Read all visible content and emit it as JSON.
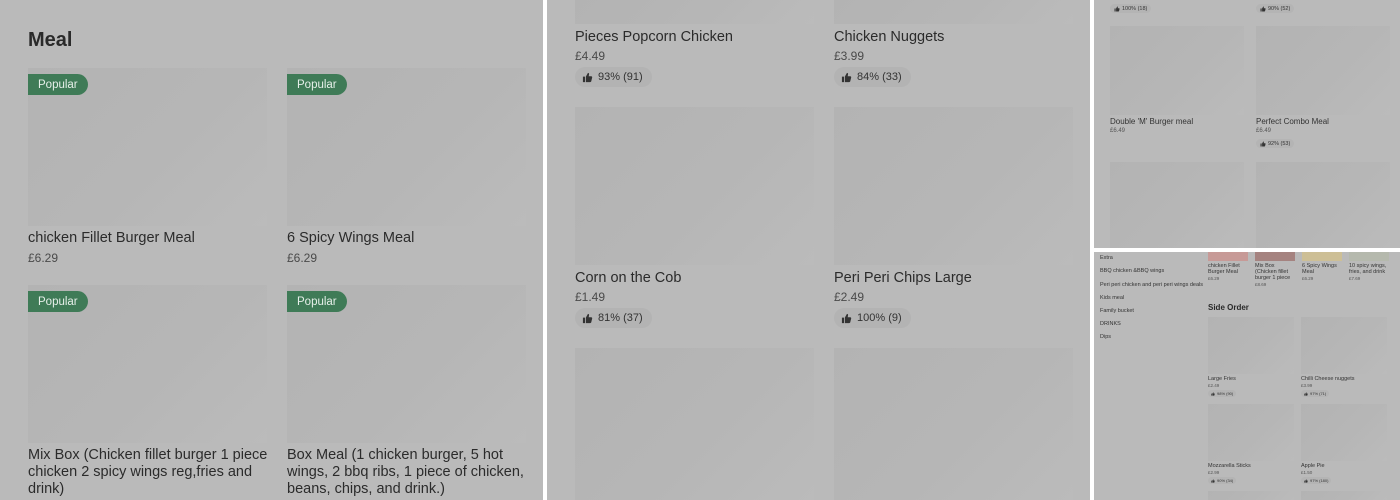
{
  "colors": {
    "panel_bg": "#bababa",
    "badge_green": "#3f7b57",
    "image_placeholder": "#b5b5b5"
  },
  "icons": {
    "rating": "thumbs-up-icon"
  },
  "panel1": {
    "section_title": "Meal",
    "items": [
      {
        "badge": "Popular",
        "name": "chicken Fillet Burger Meal",
        "price": "£6.29"
      },
      {
        "badge": "Popular",
        "name": "6 Spicy Wings Meal",
        "price": "£6.29"
      },
      {
        "badge": "Popular",
        "name": "Mix Box (Chicken fillet burger 1 piece chicken 2 spicy wings reg,fries and drink)"
      },
      {
        "badge": "Popular",
        "name": "Box Meal (1 chicken burger, 5 hot wings, 2 bbq ribs, 1 piece of chicken, beans, chips, and drink.)"
      }
    ]
  },
  "panel2": {
    "items": [
      {
        "name": "Pieces Popcorn Chicken",
        "price": "£4.49",
        "rating": "93% (91)"
      },
      {
        "name": "Chicken Nuggets",
        "price": "£3.99",
        "rating": "84% (33)"
      },
      {
        "name": "Corn on the Cob",
        "price": "£1.49",
        "rating": "81% (37)"
      },
      {
        "name": "Peri Peri Chips Large",
        "price": "£2.49",
        "rating": "100% (9)"
      }
    ]
  },
  "panel3": {
    "top_ratings": [
      "100% (18)",
      "90% (52)"
    ],
    "items": [
      {
        "name": "Double 'M' Burger meal",
        "price": "£6.49"
      },
      {
        "name": "Perfect Combo Meal",
        "price": "£6.49",
        "rating": "92% (53)"
      }
    ]
  },
  "panel4": {
    "nav_items": [
      "Extra",
      "BBQ chicken &BBQ wings",
      "Peri peri chicken and peri peri wings deals",
      "Kids meal",
      "Family bucket",
      "DRINKS",
      "Dips"
    ],
    "carousel": [
      {
        "name": "chicken Fillet Burger Meal",
        "price": "£6.29"
      },
      {
        "name": "Mix Box (Chicken fillet burger 1 piece",
        "price": "£8.69"
      },
      {
        "name": "6 Spicy Wings Meal",
        "price": "£6.29"
      },
      {
        "name": "10 spicy wings, fries, and drink",
        "price": "£7.69"
      }
    ],
    "section_title": "Side Order",
    "items": [
      {
        "name": "Large Fries",
        "price": "£2.49",
        "rating": "98% (90)"
      },
      {
        "name": "Chilli Cheese nuggets",
        "price": "£3.99",
        "rating": "97% (71)"
      },
      {
        "name": "Mozzarella Sticks",
        "price": "£2.99",
        "rating": "90% (34)"
      },
      {
        "name": "Apple Pie",
        "price": "£1.50",
        "rating": "97% (180)"
      }
    ]
  }
}
